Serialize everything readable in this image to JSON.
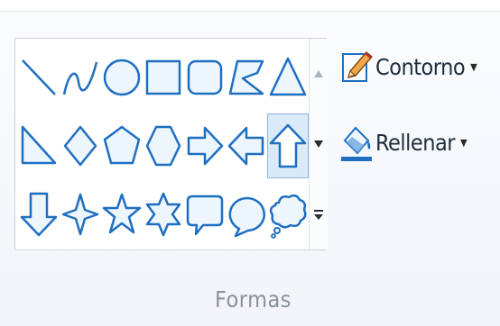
{
  "shapes": {
    "items": [
      {
        "name": "line-icon"
      },
      {
        "name": "curve-icon"
      },
      {
        "name": "oval-icon"
      },
      {
        "name": "rectangle-icon"
      },
      {
        "name": "rounded-rectangle-icon"
      },
      {
        "name": "polygon-icon"
      },
      {
        "name": "triangle-icon"
      },
      {
        "name": "right-triangle-icon"
      },
      {
        "name": "diamond-icon"
      },
      {
        "name": "pentagon-icon"
      },
      {
        "name": "hexagon-icon"
      },
      {
        "name": "right-arrow-icon"
      },
      {
        "name": "left-arrow-icon"
      },
      {
        "name": "up-arrow-icon",
        "selected": true
      },
      {
        "name": "down-arrow-icon"
      },
      {
        "name": "four-point-star-icon"
      },
      {
        "name": "five-point-star-icon"
      },
      {
        "name": "six-point-star-icon"
      },
      {
        "name": "rounded-callout-icon"
      },
      {
        "name": "oval-callout-icon"
      },
      {
        "name": "cloud-callout-icon"
      }
    ]
  },
  "outline": {
    "label": "Contorno",
    "icon": "pencil-icon",
    "arrow": "▼"
  },
  "fill": {
    "label": "Rellenar",
    "icon": "paint-bucket-icon",
    "arrow": "▼"
  },
  "group": {
    "label": "Formas"
  },
  "colors": {
    "shape_stroke": "#1f6fc1",
    "shape_fill_light": "#eef6fd",
    "selected_bg": "#dbeaf8"
  }
}
